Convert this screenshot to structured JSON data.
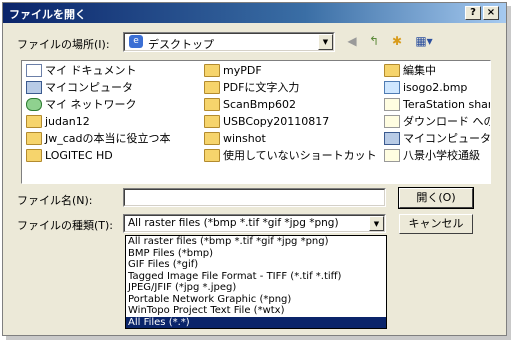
{
  "window": {
    "title": "ファイルを開く",
    "help_label": "?",
    "close_label": "×"
  },
  "look_in": {
    "label": "ファイルの場所(I):",
    "value": "デスクトップ"
  },
  "toolbar": {
    "back_icon": "back-arrow-icon",
    "up_icon": "up-folder-icon",
    "new_folder_icon": "new-folder-icon",
    "view_icon": "view-menu-icon"
  },
  "files": [
    {
      "name": "マイ ドキュメント",
      "icon": "documents-icon"
    },
    {
      "name": "マイコンピュータ",
      "icon": "computer-icon"
    },
    {
      "name": "マイ ネットワーク",
      "icon": "network-icon"
    },
    {
      "name": "judan12",
      "icon": "folder-icon"
    },
    {
      "name": "Jw_cadの本当に役立つ本",
      "icon": "folder-icon"
    },
    {
      "name": "LOGITEC HD",
      "icon": "folder-icon"
    },
    {
      "name": "myPDF",
      "icon": "folder-icon"
    },
    {
      "name": "PDFに文字入力",
      "icon": "folder-icon"
    },
    {
      "name": "ScanBmp602",
      "icon": "folder-icon"
    },
    {
      "name": "USBCopy20110817",
      "icon": "folder-icon"
    },
    {
      "name": "winshot",
      "icon": "folder-icon"
    },
    {
      "name": "使用していないショートカット",
      "icon": "folder-icon"
    },
    {
      "name": "編集中",
      "icon": "folder-icon"
    },
    {
      "name": "isogo2.bmp",
      "icon": "image-icon"
    },
    {
      "name": "TeraStation shar",
      "icon": "shortcut-icon"
    },
    {
      "name": "ダウンロード へのシ",
      "icon": "shortcut-icon"
    },
    {
      "name": "マイコンピュータ",
      "icon": "shortcut-icon"
    },
    {
      "name": "八景小学校通級",
      "icon": "shortcut-icon"
    }
  ],
  "filename": {
    "label": "ファイル名(N):",
    "value": ""
  },
  "filetype": {
    "label": "ファイルの種類(T):",
    "value": "All raster files (*bmp *.tif *gif *jpg *png)"
  },
  "buttons": {
    "open": "開く(O)",
    "cancel": "キャンセル"
  },
  "filetype_options": [
    "All raster files (*bmp *.tif *gif *jpg *png)",
    "BMP Files (*bmp)",
    "GIF Files (*gif)",
    "Tagged Image File Format - TIFF (*.tif *.tiff)",
    "JPEG/JFIF (*jpg *.jpeg)",
    "Portable Network Graphic (*png)",
    "WinTopo Project Text File (*wtx)",
    "All Files (*.*)"
  ]
}
